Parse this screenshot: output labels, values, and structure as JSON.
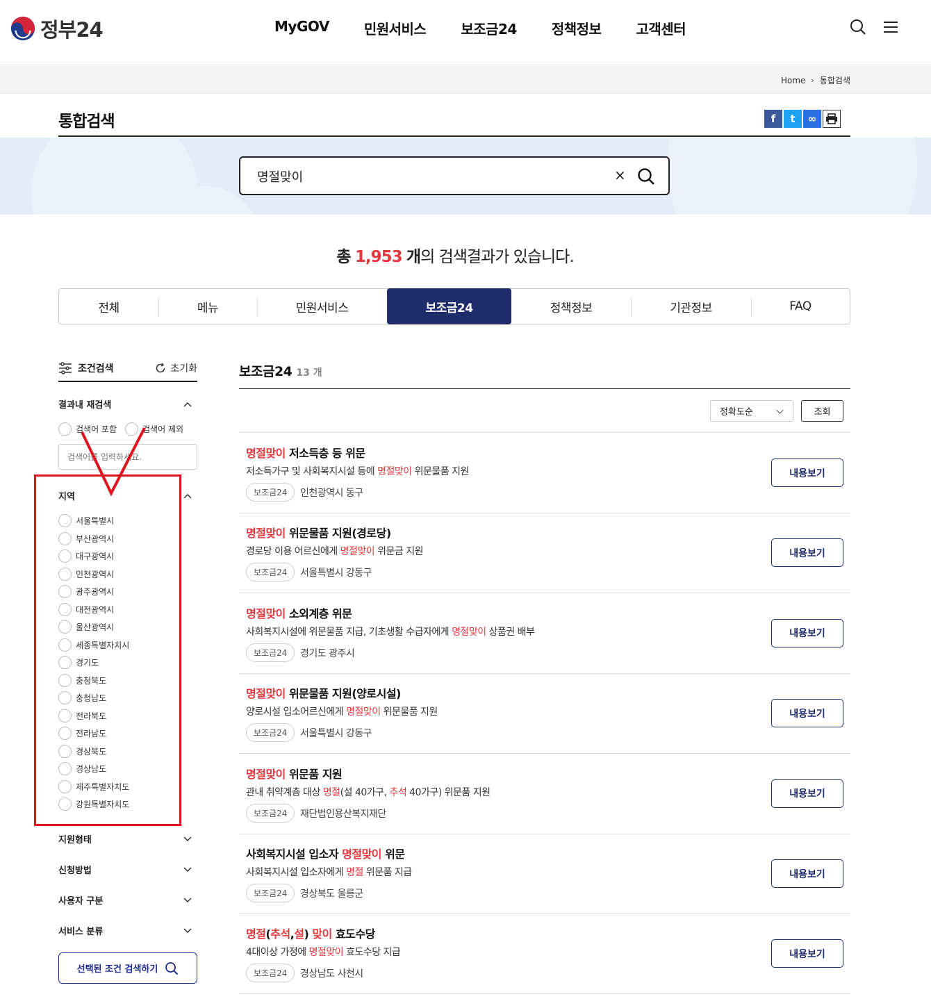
{
  "header": {
    "logo_text": "정부24",
    "nav": [
      "MyGOV",
      "민원서비스",
      "보조금24",
      "정책정보",
      "고객센터"
    ],
    "icons": [
      "search-icon",
      "menu-icon"
    ]
  },
  "breadcrumb": {
    "home": "Home",
    "current": "통합검색"
  },
  "page": {
    "title": "통합검색"
  },
  "share": {
    "facebook": "f",
    "twitter": "t",
    "link": "∞",
    "print": "🖶"
  },
  "search": {
    "value": "명절맞이",
    "clear": "×"
  },
  "summary": {
    "prefix": "총",
    "count": "1,953",
    "unit": "개",
    "suffix": "의 검색결과가 있습니다."
  },
  "tabs": [
    {
      "label": "전체",
      "active": false
    },
    {
      "label": "메뉴",
      "active": false
    },
    {
      "label": "민원서비스",
      "active": false
    },
    {
      "label": "보조금24",
      "active": true
    },
    {
      "label": "정책정보",
      "active": false
    },
    {
      "label": "기관정보",
      "active": false
    },
    {
      "label": "FAQ",
      "active": false
    }
  ],
  "filter": {
    "title": "조건검색",
    "reset": "초기화",
    "refine_title": "결과내 재검색",
    "include": "검색어 포함",
    "exclude": "검색어 제외",
    "refine_placeholder": "검색어를 입력하세요.",
    "region_title": "지역",
    "regions": [
      "서울특별시",
      "부산광역시",
      "대구광역시",
      "인천광역시",
      "광주광역시",
      "대전광역시",
      "울산광역시",
      "세종특별자치시",
      "경기도",
      "충청북도",
      "충청남도",
      "전라북도",
      "전라남도",
      "경상북도",
      "경상남도",
      "제주특별자치도",
      "강원특별자치도"
    ],
    "collapsed_sections": [
      "지원형태",
      "신청방법",
      "사용자 구분",
      "서비스 분류"
    ],
    "submit": "선택된 조건 검색하기"
  },
  "results": {
    "title": "보조금24",
    "count": "13 개",
    "sort_selected": "정확도순",
    "sort_button": "조회",
    "view_label": "내용보기",
    "items": [
      {
        "title_parts": [
          {
            "t": "명절맞이",
            "h": true
          },
          {
            "t": " 저소득층 등 위문",
            "h": false
          }
        ],
        "desc_parts": [
          {
            "t": "저소득가구 및 사회복지시설 등에 ",
            "h": false
          },
          {
            "t": "명절맞이",
            "h": true
          },
          {
            "t": " 위문물품 지원",
            "h": false
          }
        ],
        "badge": "보조금24",
        "org": "인천광역시 동구"
      },
      {
        "title_parts": [
          {
            "t": "명절맞이",
            "h": true
          },
          {
            "t": " 위문물품 지원(경로당)",
            "h": false
          }
        ],
        "desc_parts": [
          {
            "t": "경로당 이용 어르신에게 ",
            "h": false
          },
          {
            "t": "명절맞이",
            "h": true
          },
          {
            "t": " 위문금 지원",
            "h": false
          }
        ],
        "badge": "보조금24",
        "org": "서울특별시 강동구"
      },
      {
        "title_parts": [
          {
            "t": "명절맞이",
            "h": true
          },
          {
            "t": " 소외계층 위문",
            "h": false
          }
        ],
        "desc_parts": [
          {
            "t": "사회복지시설에 위문물품 지급, 기초생활 수급자에게 ",
            "h": false
          },
          {
            "t": "명절맞이",
            "h": true
          },
          {
            "t": " 상품권 배부",
            "h": false
          }
        ],
        "badge": "보조금24",
        "org": "경기도 광주시"
      },
      {
        "title_parts": [
          {
            "t": "명절맞이",
            "h": true
          },
          {
            "t": " 위문물품 지원(양로시설)",
            "h": false
          }
        ],
        "desc_parts": [
          {
            "t": "양로시설 입소어르신에게 ",
            "h": false
          },
          {
            "t": "명절맞이",
            "h": true
          },
          {
            "t": " 위문물품 지원",
            "h": false
          }
        ],
        "badge": "보조금24",
        "org": "서울특별시 강동구"
      },
      {
        "title_parts": [
          {
            "t": "명절맞이",
            "h": true
          },
          {
            "t": " 위문품 지원",
            "h": false
          }
        ],
        "desc_parts": [
          {
            "t": "관내 취약계층 대상 ",
            "h": false
          },
          {
            "t": "명절",
            "h": true
          },
          {
            "t": "(설 40가구, ",
            "h": false
          },
          {
            "t": "추석",
            "h": true
          },
          {
            "t": " 40가구) 위문품 지원",
            "h": false
          }
        ],
        "badge": "보조금24",
        "org": "재단법인용산복지재단"
      },
      {
        "title_parts": [
          {
            "t": "사회복지시설 입소자 ",
            "h": false
          },
          {
            "t": "명절맞이",
            "h": true
          },
          {
            "t": " 위문",
            "h": false
          }
        ],
        "desc_parts": [
          {
            "t": "사회복지시설 입소자에게 ",
            "h": false
          },
          {
            "t": "명절",
            "h": true
          },
          {
            "t": " 위문품 지급",
            "h": false
          }
        ],
        "badge": "보조금24",
        "org": "경상북도 울릉군"
      },
      {
        "title_parts": [
          {
            "t": "명절",
            "h": true
          },
          {
            "t": "(",
            "h": false
          },
          {
            "t": "추석",
            "h": true
          },
          {
            "t": ",",
            "h": false
          },
          {
            "t": "설",
            "h": true
          },
          {
            "t": ") ",
            "h": false
          },
          {
            "t": "맞이",
            "h": true
          },
          {
            "t": " 효도수당",
            "h": false
          }
        ],
        "desc_parts": [
          {
            "t": "4대이상 가정에 ",
            "h": false
          },
          {
            "t": "명절맞이",
            "h": true
          },
          {
            "t": " 효도수당 지급",
            "h": false
          }
        ],
        "badge": "보조금24",
        "org": "경상남도 사천시"
      }
    ]
  },
  "colors": {
    "accent": "#1f2c6b",
    "highlight": "#e03a3e",
    "annotation": "#e0141e"
  }
}
